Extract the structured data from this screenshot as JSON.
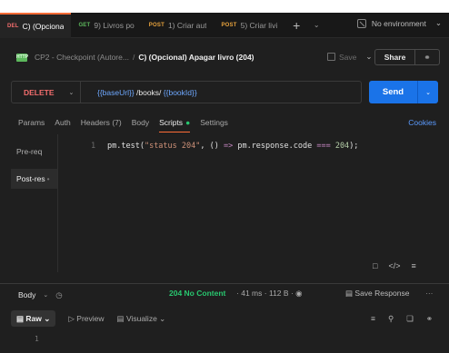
{
  "tabs": [
    {
      "method": "DEL",
      "title": "C) (Opciona",
      "active": true
    },
    {
      "method": "GET",
      "title": "9) Livros po",
      "active": false
    },
    {
      "method": "POST",
      "title": "1) Criar aut",
      "active": false
    },
    {
      "method": "POST",
      "title": "5) Criar livi",
      "active": false
    }
  ],
  "tab_new_label": "+",
  "environment": "No environment",
  "breadcrumb": {
    "icon_text": "HTTP",
    "collection": "CP2 - Checkpoint (Autore...",
    "separator": "/",
    "request": "C) (Opcional) Apagar livro (204)"
  },
  "save_label": "Save",
  "share_label": "Share",
  "request": {
    "method": "DELETE",
    "url_parts": [
      {
        "text": "{{baseUrl}}",
        "var": true
      },
      {
        "text": " /books/ ",
        "var": false
      },
      {
        "text": "{{bookId}}",
        "var": true
      }
    ]
  },
  "send_label": "Send",
  "request_tabs": {
    "params": "Params",
    "auth": "Auth",
    "headers": "Headers",
    "headers_count": "(7)",
    "body": "Body",
    "scripts": "Scripts",
    "settings": "Settings"
  },
  "cookies_label": "Cookies",
  "script_sections": {
    "pre": "Pre-req",
    "post": "Post-res"
  },
  "code": {
    "line": "1",
    "prefix": "pm.test(",
    "string": "\"status 204\"",
    "mid": ", () ",
    "arrow": "=>",
    "expr": " pm.response.code ",
    "eq": "===",
    "num": " 204",
    "suffix": ");"
  },
  "response": {
    "body_label": "Body",
    "status": "204 No Content",
    "time": "41 ms",
    "size": "112 B",
    "save_response": "Save Response",
    "raw_label": "Raw",
    "preview_label": "Preview",
    "visualize_label": "Visualize",
    "line": "1"
  },
  "colors": {
    "accent": "#ff6c37",
    "send": "#1a73e8",
    "delete": "#f26d6d",
    "status_ok": "#28c76f"
  }
}
